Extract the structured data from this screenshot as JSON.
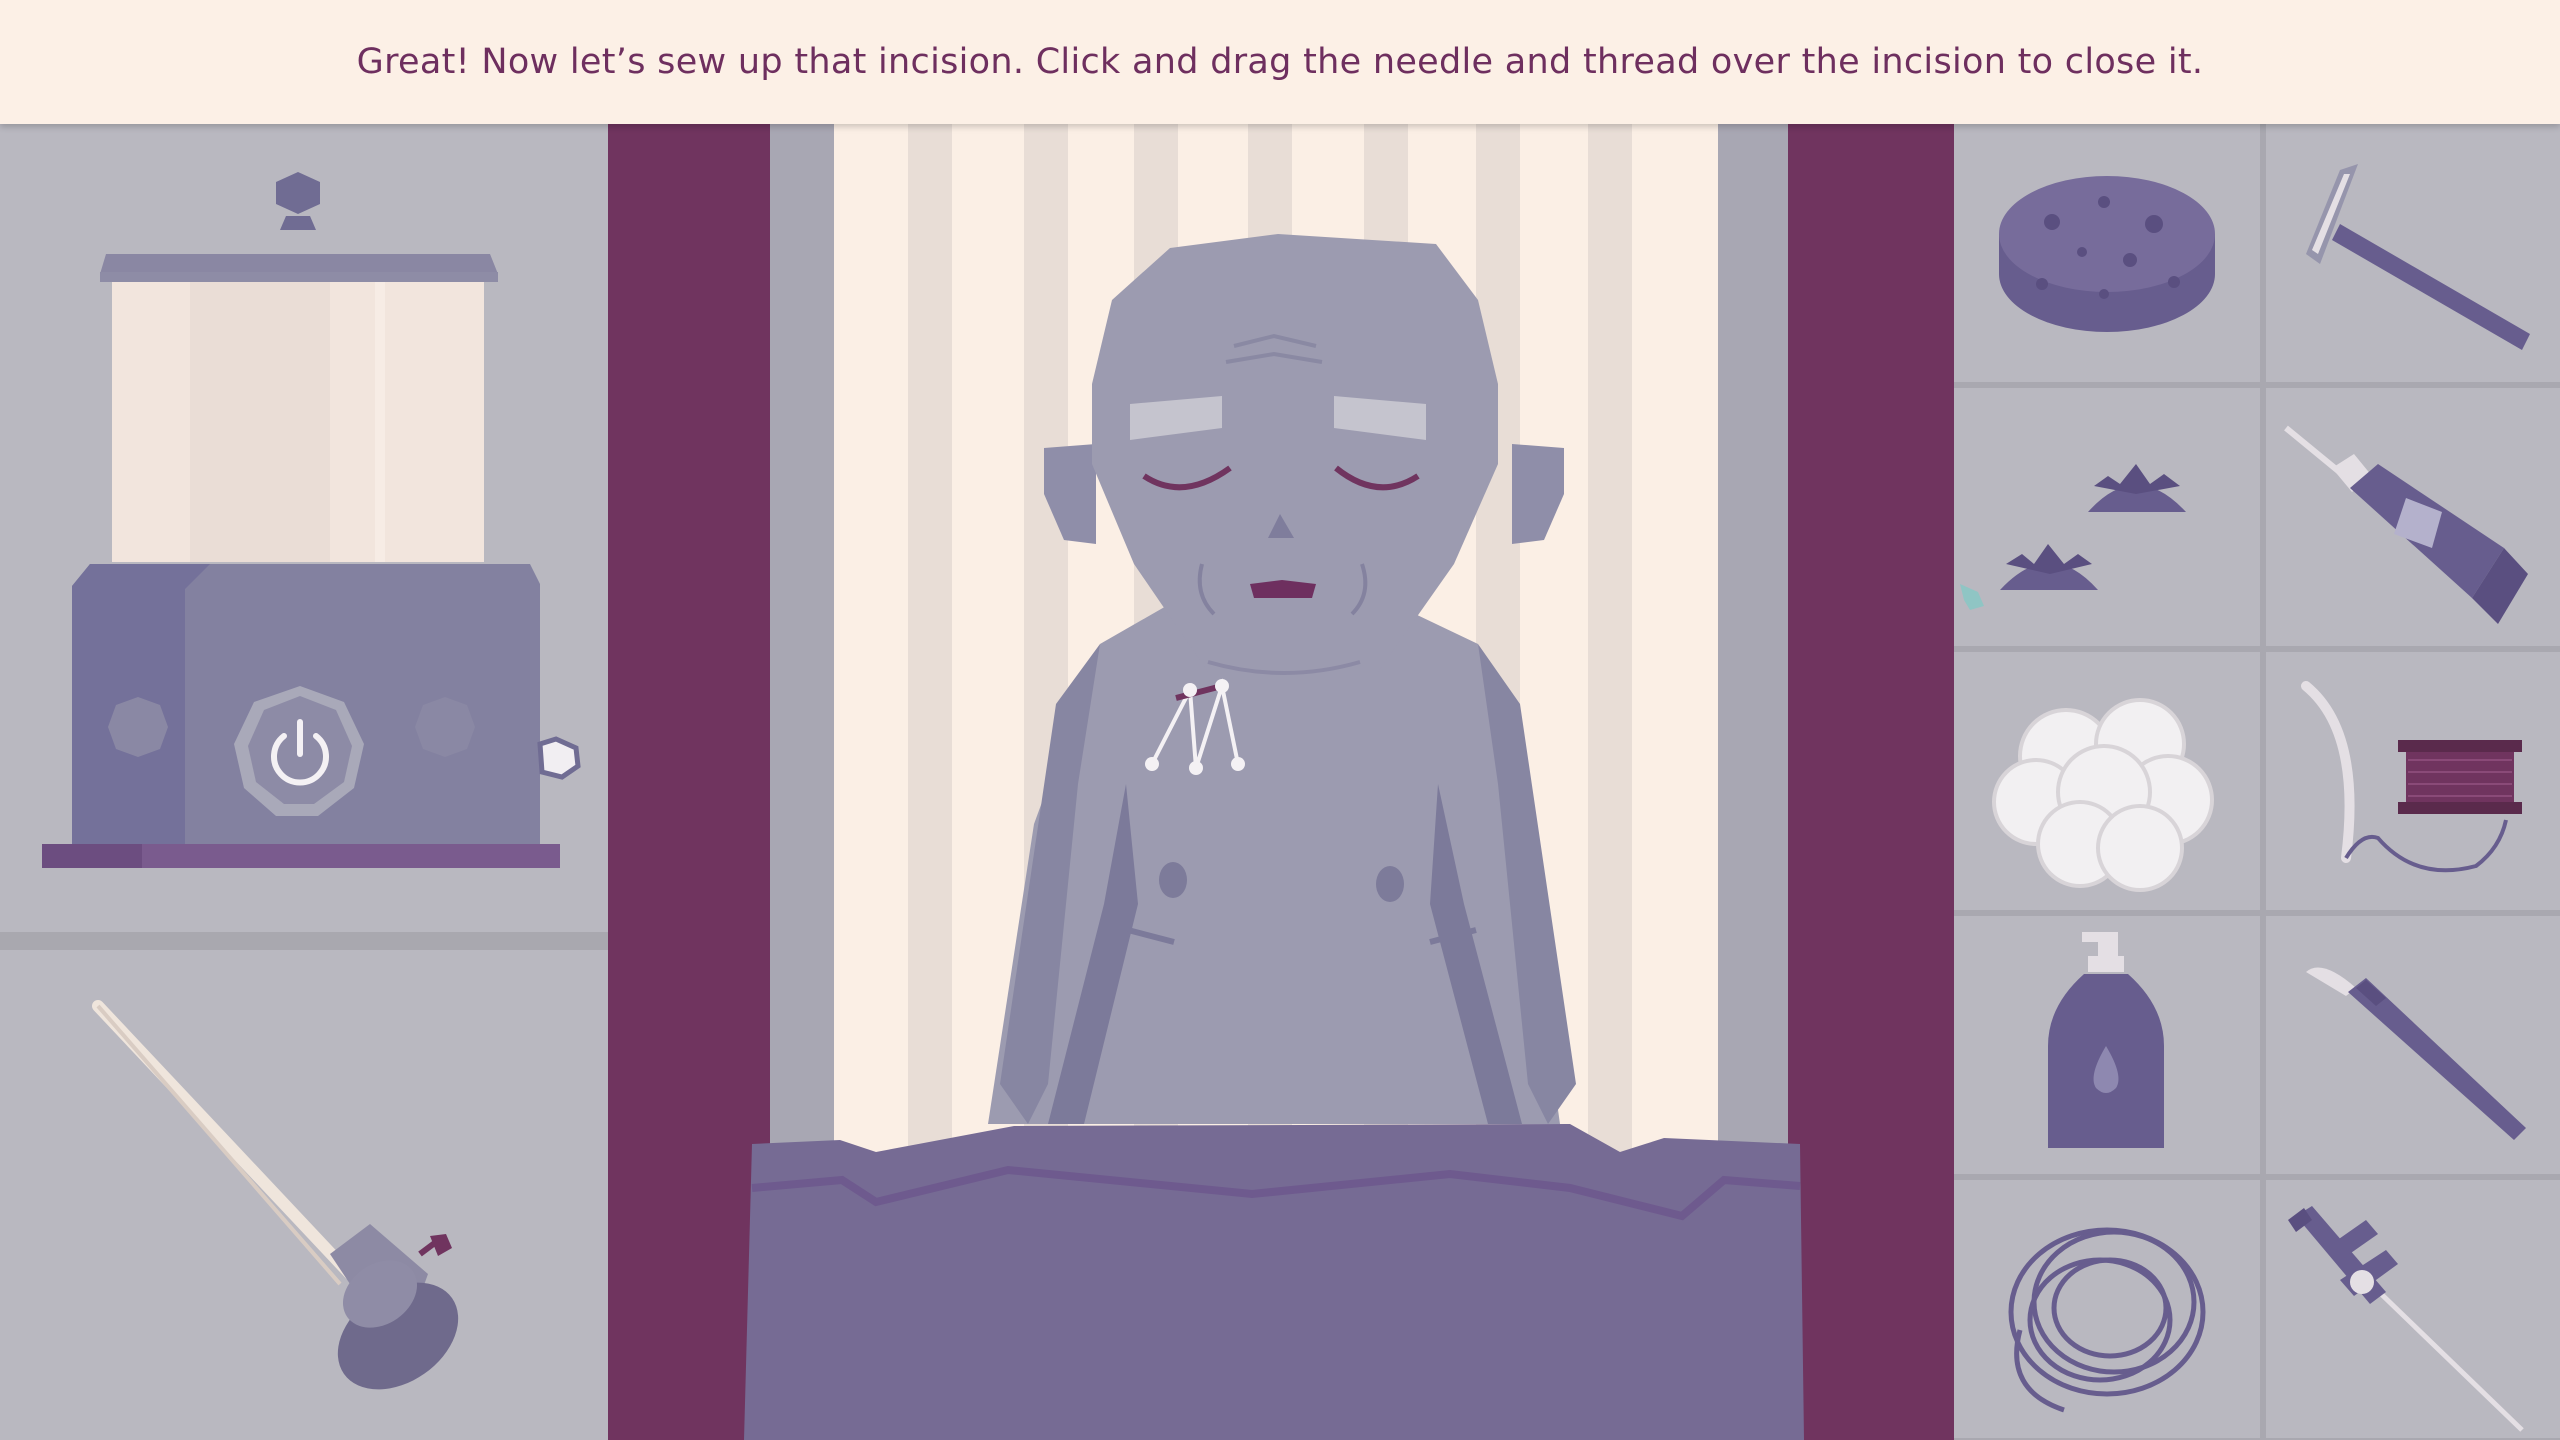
{
  "instruction": "Great! Now let’s sew up that incision. Click and drag the needle and thread over the incision to close it.",
  "left_panel": {
    "sterilizer": {
      "icon": "power-icon"
    },
    "tool": {
      "icon": "trocar-icon"
    }
  },
  "patient": {
    "state": "incision-sewn",
    "stitch_icon": "suture-stitches-icon"
  },
  "tray": [
    {
      "icon": "sponge-icon"
    },
    {
      "icon": "razor-icon"
    },
    {
      "icon": "eye-caps-icon"
    },
    {
      "icon": "glue-tube-icon"
    },
    {
      "icon": "cotton-balls-icon"
    },
    {
      "icon": "needle-and-thread-icon"
    },
    {
      "icon": "lotion-bottle-icon"
    },
    {
      "icon": "scalpel-icon"
    },
    {
      "icon": "tubing-coil-icon"
    },
    {
      "icon": "cannula-icon"
    }
  ],
  "colors": {
    "text": "#6e2f5f",
    "banner": "#fcf0e6",
    "curtain": "#70345f",
    "panel": "#b9b8c0",
    "tool": "#6f6a8c",
    "sheet": "#766b94",
    "skin": "#9b9aae",
    "cursor": "#8fc5c4"
  }
}
